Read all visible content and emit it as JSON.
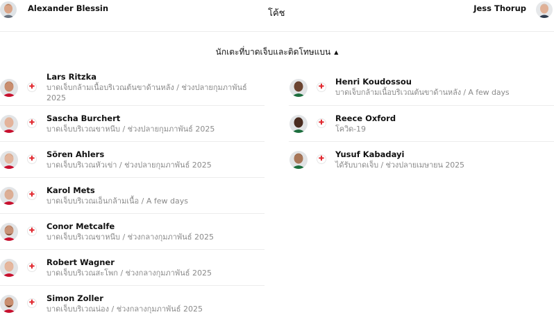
{
  "coaches": {
    "title": "โค้ช",
    "home": {
      "name": "Alexander Blessin"
    },
    "away": {
      "name": "Jess Thorup"
    }
  },
  "section": {
    "title": "นักเตะที่บาดเจ็บและติดโทษแบน",
    "caret_icon": "caret-up-icon"
  },
  "status_icon": "red-cross-icon",
  "colors": {
    "injury_cross": "#e0242b",
    "secondary_text": "#8a8a8a",
    "divider": "#ececec"
  },
  "home_players": [
    {
      "name": "Lars Ritzka",
      "info": "บาดเจ็บกล้ามเนื้อบริเวณต้นขาด้านหลัง / ช่วงปลายกุมภาพันธ์ 2025"
    },
    {
      "name": "Sascha Burchert",
      "info": "บาดเจ็บบริเวณขาหนีบ / ช่วงปลายกุมภาพันธ์ 2025"
    },
    {
      "name": "Sören Ahlers",
      "info": "บาดเจ็บบริเวณหัวเข่า / ช่วงปลายกุมภาพันธ์ 2025"
    },
    {
      "name": "Karol Mets",
      "info": "บาดเจ็บบริเวณเอ็นกล้ามเนื้อ / A few days"
    },
    {
      "name": "Conor Metcalfe",
      "info": "บาดเจ็บบริเวณขาหนีบ / ช่วงกลางกุมภาพันธ์ 2025"
    },
    {
      "name": "Robert Wagner",
      "info": "บาดเจ็บบริเวณสะโพก / ช่วงกลางกุมภาพันธ์ 2025"
    },
    {
      "name": "Simon Zoller",
      "info": "บาดเจ็บบริเวณน่อง / ช่วงกลางกุมภาพันธ์ 2025"
    }
  ],
  "away_players": [
    {
      "name": "Henri Koudossou",
      "info": "บาดเจ็บกล้ามเนื้อบริเวณต้นขาด้านหลัง / A few days"
    },
    {
      "name": "Reece Oxford",
      "info": "โควิด-19"
    },
    {
      "name": "Yusuf Kabadayi",
      "info": "ได้รับบาดเจ็บ / ช่วงปลายเมษายน 2025"
    }
  ]
}
